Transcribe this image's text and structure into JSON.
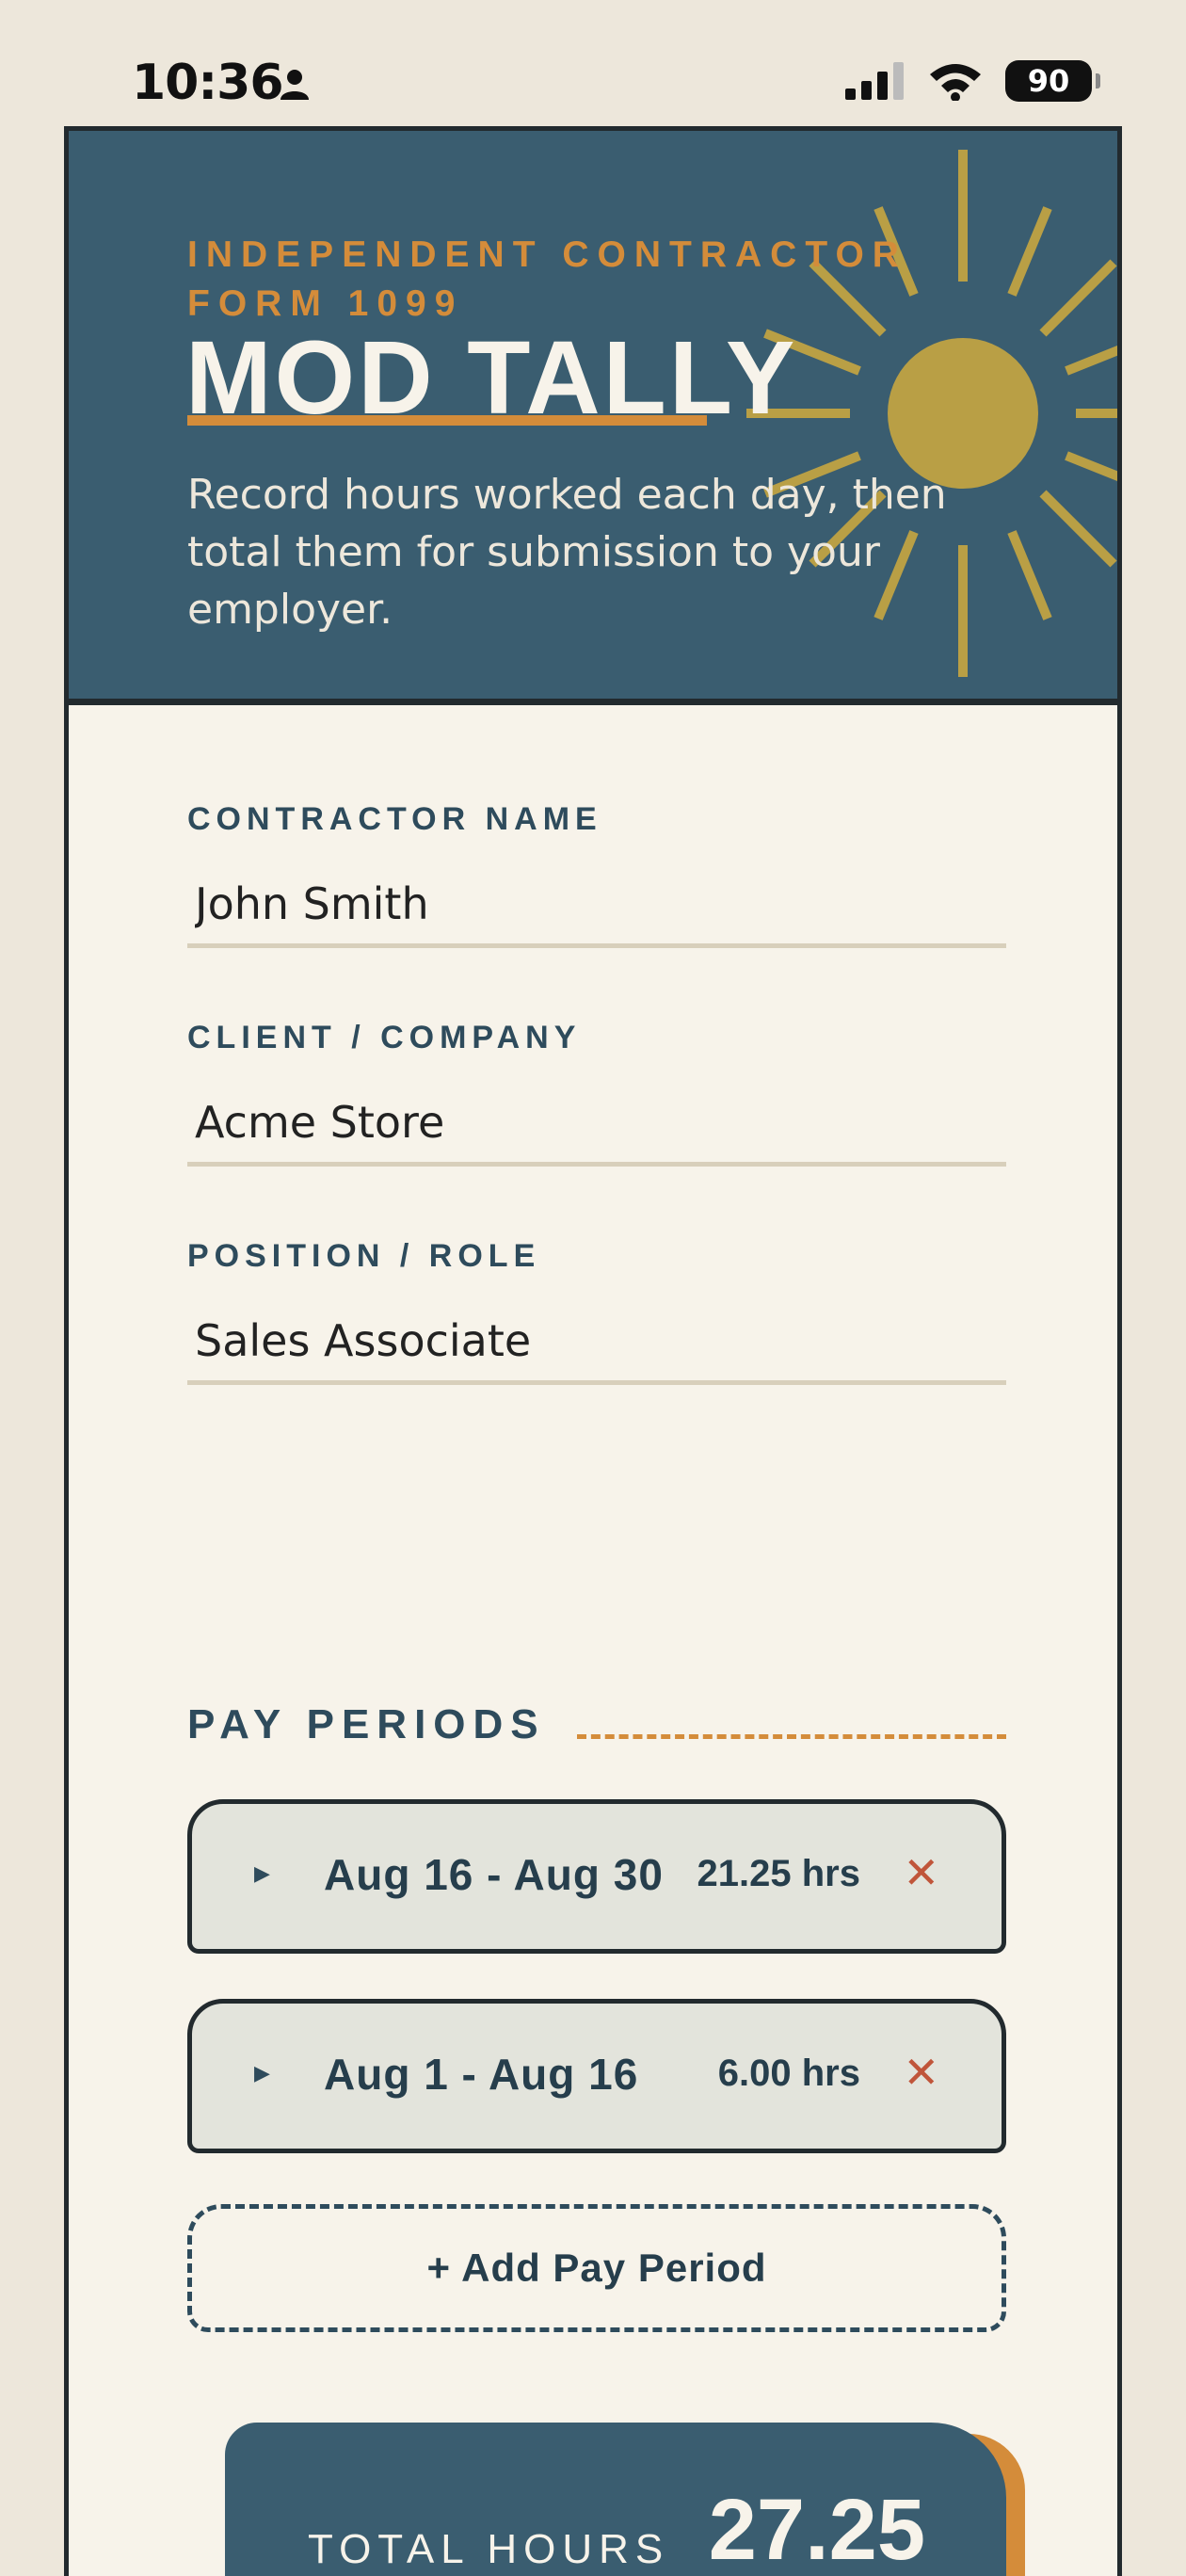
{
  "status_bar": {
    "time": "10:36",
    "battery": "90"
  },
  "header": {
    "eyebrow": "INDEPENDENT CONTRACTOR FORM 1099",
    "title": "MOD TALLY",
    "subtitle": "Record hours worked each day, then total them for submission to your employer."
  },
  "form": {
    "contractor_name": {
      "label": "CONTRACTOR NAME",
      "value": "John Smith"
    },
    "client_company": {
      "label": "CLIENT / COMPANY",
      "value": "Acme Store"
    },
    "position_role": {
      "label": "POSITION / ROLE",
      "value": "Sales Associate"
    }
  },
  "pay_periods": {
    "title": "PAY PERIODS",
    "items": [
      {
        "range": "Aug 16 - Aug 30",
        "hours": "21.25 hrs"
      },
      {
        "range": "Aug 1 - Aug 16",
        "hours": "6.00 hrs"
      }
    ],
    "add_label": "+ Add Pay Period"
  },
  "totals": {
    "label": "TOTAL HOURS",
    "value": "27.25"
  },
  "colors": {
    "navy": "#3a5d70",
    "orange": "#d48c3a",
    "sun": "#b99f45",
    "cream": "#f7f3ea",
    "delete": "#c0553a"
  }
}
